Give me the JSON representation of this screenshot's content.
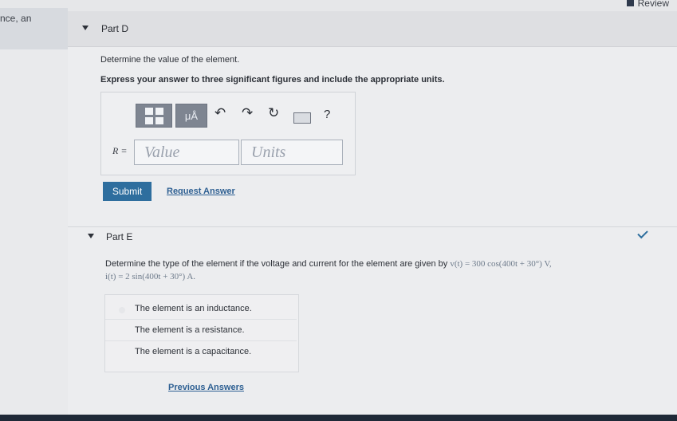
{
  "header": {
    "review_label": "Review"
  },
  "left": {
    "text": "nce, an"
  },
  "partD": {
    "title": "Part D",
    "instruction": "Determine the value of the element.",
    "express": "Express your answer to three significant figures and include the appropriate units.",
    "toolbar": {
      "units_button": "μÅ",
      "help": "?"
    },
    "answer_label": "R =",
    "value_placeholder": "Value",
    "units_placeholder": "Units",
    "submit_label": "Submit",
    "request_answer": "Request Answer"
  },
  "partE": {
    "title": "Part E",
    "question_prefix": "Determine the type of the element if the voltage and current for the element are given by",
    "voltage_expr": "v(t) = 300 cos(400t + 30°) V,",
    "current_expr": "i(t) = 2 sin(400t + 30°) A.",
    "options": [
      "The element is an inductance.",
      "The element is a resistance.",
      "The element is a capacitance."
    ],
    "previous_answers": "Previous Answers"
  }
}
